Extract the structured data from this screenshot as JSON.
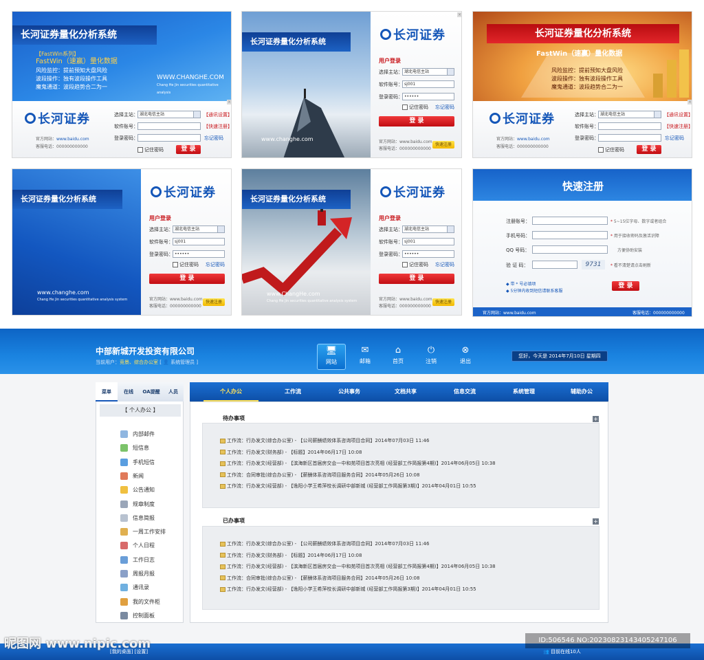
{
  "login_title": "长河证券量化分析系统",
  "logo_text": "长河证券",
  "banner1": {
    "series": "【FastWin系列】",
    "line1": "FastWin（速赢）量化数据",
    "line2": "风险监控：提前预知大盘风险",
    "line3": "波段操作：独有波段操作工具",
    "line4": "魔鬼通道：波段趋势合二为一",
    "url": "WWW.CHANGHE.COM",
    "url_sub": "Chang He Jin securities quantitative analysis"
  },
  "banner3": {
    "line1": "FastWin（速赢）量化数据",
    "line2": "风险监控：提前预知大盘风险",
    "line3": "波段操作：独有波段操作工具",
    "line4": "魔鬼通道：波段趋势合二为一"
  },
  "url_lower": "www.changhe.com",
  "url_mixed": "www.ChangHe.com",
  "url_sub": "Chang He Jin securities quantitative analysis system",
  "login": {
    "user_login": "用户登录",
    "server_label": "选择主站：",
    "server_value": "湖北电信主站",
    "account_label": "软件账号：",
    "account_value": "sj001",
    "password_label": "登录密码：",
    "password_value": "••••••",
    "remember": "记住密码",
    "forgot": "忘记密码",
    "server_settings": "【通讯设置】",
    "quick_register": "【快速注册】",
    "login_button": "登 录",
    "quick_btn": "快速注册",
    "site_label": "官方网站：",
    "site_value": "www.baidu.com",
    "phone_label": "客服电话：",
    "phone_value": "000000000000"
  },
  "register": {
    "title": "快速注册",
    "account_label": "注册账号：",
    "account_hint": "5~15位字母、数字或者组合",
    "phone_label": "手机号码：",
    "phone_hint": "用于接收密码及激活识障",
    "qq_label": "QQ 号码：",
    "qq_hint": "方便协助安装",
    "captcha_label": "验 证 码：",
    "captcha": "9731",
    "captcha_hint": "看不清楚请点击刷新",
    "note1": "◆ 带 * 号必填项",
    "note2": "◆ 5分钟内收到短信请联系客服",
    "button": "登 录",
    "site": "官方网站：www.baidu.com",
    "phone": "客服电话：000000000000"
  },
  "app": {
    "company": "中部新城开发投资有限公司",
    "current_user_label": "当前用户：",
    "current_user": "竞景、综合办公室",
    "role": "系统管理员",
    "nav": [
      "网站",
      "邮箱",
      "首页",
      "注销",
      "退出"
    ],
    "date": "您好，今天是 2014年7月10日 星期四",
    "side_tabs": [
      "菜单",
      "在线",
      "OA提醒",
      "人员"
    ],
    "side_header": "【 个人办公 】",
    "side_items": [
      "内部邮件",
      "短信息",
      "手机短信",
      "新闻",
      "公告通知",
      "规章制度",
      "信息简报",
      "一周工作安排",
      "个人日程",
      "工作日志",
      "周报月报",
      "通讯录",
      "我的文件柜",
      "控制面板"
    ],
    "main_tabs": [
      "个人办公",
      "工作流",
      "公共事务",
      "文档共享",
      "信息交流",
      "系统管理",
      "辅助办公"
    ],
    "todo_title": "待办事项",
    "done_title": "已办事项",
    "rows": [
      "工作流：行办发文(综合办公室) - 【公司薪酬绩效体系咨询项目合同】2014年07月03日 11:46",
      "工作流：行办发文(财务部) - 【标题】2014年06月17日 10:08",
      "工作流：行办发文(经营部) - 【滨海新区首届房交会一中和苑项目首次亮相 (经营部工作简报第4期)】2014年06月05日 10:38",
      "工作流：合同审批(综合办公室) - 【薪酬体系咨询项目服务合同】2014年05月26日 10:08",
      "工作流：行办发文(经营部) - 【逸阳小学王希萍校长调研中部新城 (经营部工作简报第3期)】2014年04月01日 10:55"
    ],
    "footer_left": "[我的桌面]   [设置]",
    "footer_right": "目前在线10人"
  },
  "watermark": {
    "left": "昵图网 www.nipic.com",
    "right": "ID:506546 NO:20230823143405247106"
  }
}
